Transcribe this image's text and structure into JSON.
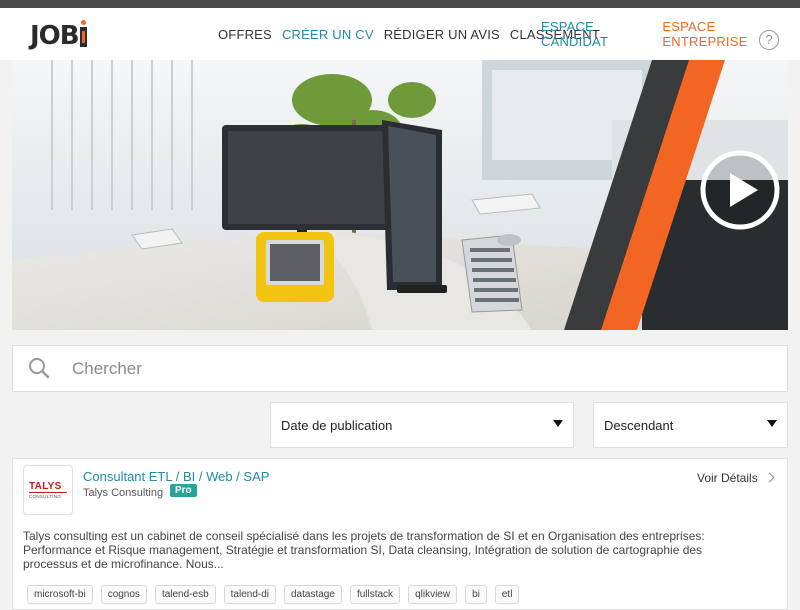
{
  "header": {
    "logo_text": "JOB",
    "nav": [
      {
        "label": "OFFRES",
        "style": "plain"
      },
      {
        "label": "CRÉER UN CV",
        "style": "accent"
      },
      {
        "label": "RÉDIGER UN AVIS",
        "style": "plain"
      },
      {
        "label": "CLASSEMENT",
        "style": "plain"
      }
    ],
    "espace_candidat": "ESPACE CANDIDAT",
    "espace_entreprise": "ESPACE ENTREPRISE",
    "help_label": "?"
  },
  "colors": {
    "accent": "#1e8ba9",
    "orange": "#f26522",
    "pro_badge": "#26a69a",
    "top_strip": "#4a4a4a"
  },
  "hero": {
    "play_icon": "play-icon"
  },
  "search": {
    "placeholder": "Chercher",
    "value": "",
    "icon": "search-icon"
  },
  "sort": {
    "field": "Date de publication",
    "order": "Descendant"
  },
  "job": {
    "title": "Consultant ETL / BI / Web / SAP",
    "company": "Talys Consulting",
    "badge": "Pro",
    "logo_text": "TALYS",
    "logo_sub": "CONSULTING",
    "details_label": "Voir Détails",
    "description": "Talys consulting est un cabinet de conseil spécialisé dans les projets de transformation de SI et en Organisation des entreprises:  Performance et Risque management, Stratégie et transformation SI, Data cleansing, Intégration de solution de cartographie des processus et de microfinance. Nous...",
    "tags": [
      "microsoft-bi",
      "cognos",
      "talend-esb",
      "talend-di",
      "datastage",
      "fullstack",
      "qlikview",
      "bi",
      "etl"
    ]
  }
}
